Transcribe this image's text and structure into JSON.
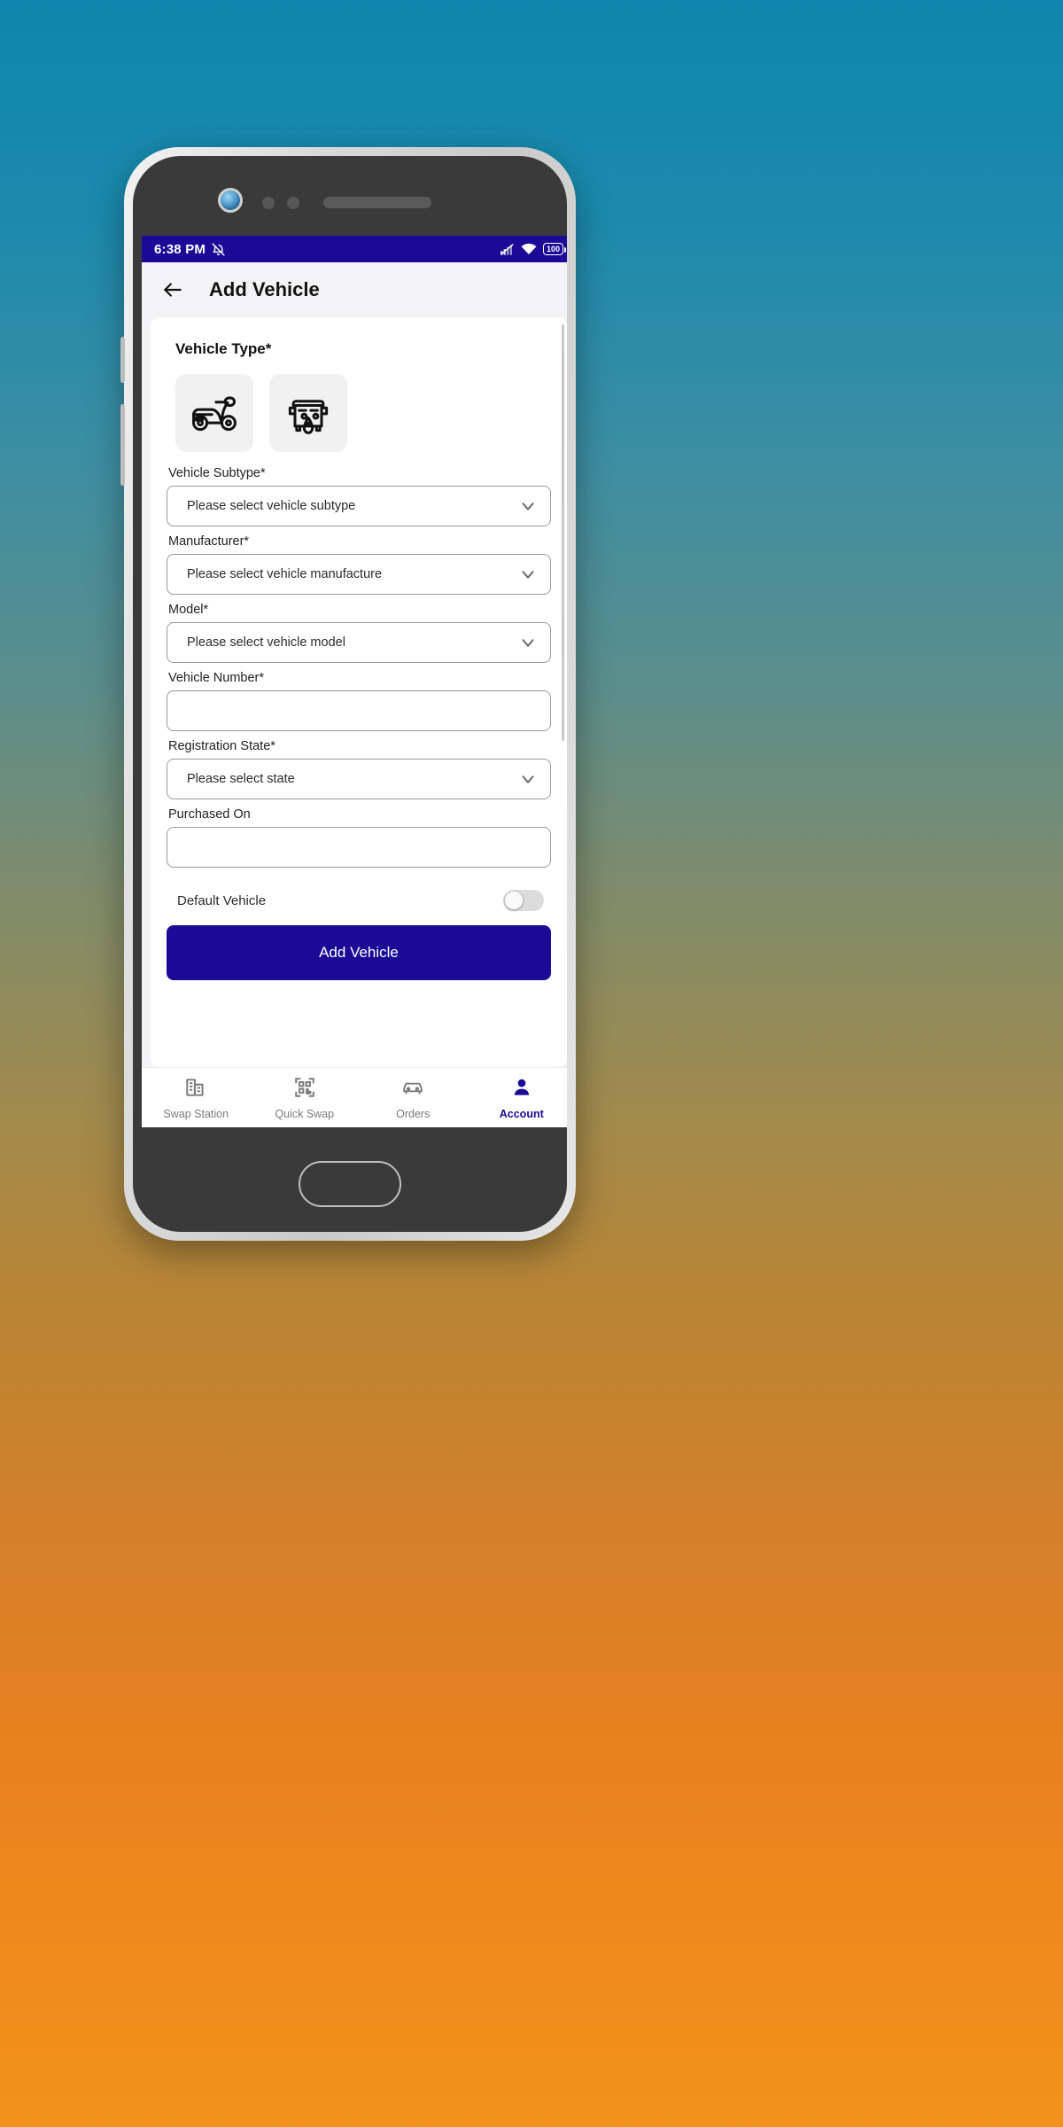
{
  "status_bar": {
    "time": "6:38 PM",
    "mute_icon": "bell-muted-icon",
    "signal_icon": "signal-bars-icon",
    "wifi_icon": "wifi-icon",
    "battery_text": "100",
    "background": "#1a0a96"
  },
  "app_bar": {
    "back_icon": "back-arrow-icon",
    "title": "Add Vehicle"
  },
  "form": {
    "section_title": "Vehicle Type*",
    "vehicle_types": [
      {
        "name": "scooter-type-option",
        "icon": "scooter-icon"
      },
      {
        "name": "auto-rickshaw-type-option",
        "icon": "auto-rickshaw-icon"
      }
    ],
    "fields": [
      {
        "label": "Vehicle Subtype*",
        "value": "Please select vehicle subtype",
        "kind": "select"
      },
      {
        "label": "Manufacturer*",
        "value": "Please select vehicle manufacture",
        "kind": "select"
      },
      {
        "label": "Model*",
        "value": "Please select vehicle model",
        "kind": "select"
      },
      {
        "label": "Vehicle Number*",
        "value": "",
        "kind": "text"
      },
      {
        "label": "Registration State*",
        "value": "Please select state",
        "kind": "select"
      },
      {
        "label": "Purchased On",
        "value": "",
        "kind": "text"
      }
    ],
    "default_vehicle": {
      "label": "Default Vehicle",
      "enabled": false
    },
    "submit_label": "Add Vehicle",
    "accent": "#1a0a96"
  },
  "bottom_nav": {
    "items": [
      {
        "label": "Swap Station",
        "icon": "building-icon",
        "active": false
      },
      {
        "label": "Quick Swap",
        "icon": "qr-code-icon",
        "active": false
      },
      {
        "label": "Orders",
        "icon": "car-icon",
        "active": false
      },
      {
        "label": "Account",
        "icon": "person-icon",
        "active": true
      }
    ]
  }
}
